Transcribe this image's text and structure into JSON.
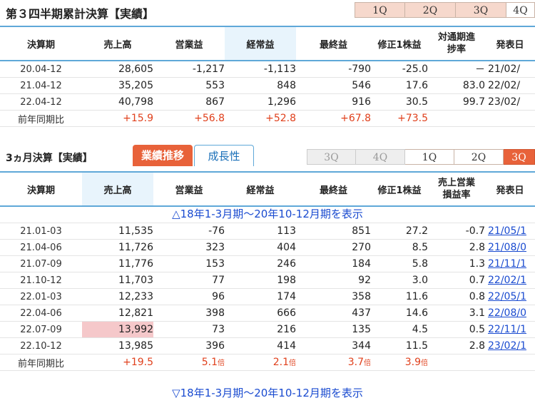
{
  "section1": {
    "title": "第３四半期累計決算【実績】",
    "tabs": [
      "1Q",
      "2Q",
      "3Q",
      "4Q"
    ],
    "headers": [
      "決算期",
      "売上高",
      "営業益",
      "経常益",
      "最終益",
      "修正1株益",
      "対通期進捗率",
      "発表日"
    ],
    "rows": [
      [
        "20.04-12",
        "28,605",
        "-1,217",
        "-1,113",
        "-790",
        "-25.0",
        "－",
        "21/02/"
      ],
      [
        "21.04-12",
        "35,205",
        "553",
        "848",
        "546",
        "17.6",
        "83.0",
        "22/02/"
      ],
      [
        "22.04-12",
        "40,798",
        "867",
        "1,296",
        "916",
        "30.5",
        "99.7",
        "23/02/"
      ]
    ],
    "yoy": [
      "前年同期比",
      "+15.9",
      "+56.8",
      "+52.8",
      "+67.8",
      "+73.5",
      "",
      ""
    ]
  },
  "section2": {
    "title": "3ヵ月決算【実績】",
    "tab_active": "業績推移",
    "tab_other": "成長性",
    "qtabs": [
      "3Q",
      "4Q",
      "1Q",
      "2Q",
      "3Q"
    ],
    "headers": [
      "決算期",
      "売上高",
      "営業益",
      "経常益",
      "最終益",
      "修正1株益",
      "売上営業損益率",
      "発表日"
    ],
    "toggle_top": "△18年1-3月期～20年10-12月期を表示",
    "toggle_bottom": "▽18年1-3月期～20年10-12月期を表示",
    "rows": [
      [
        "21.01-03",
        "11,535",
        "-76",
        "113",
        "851",
        "27.2",
        "-0.7",
        "21/05/1"
      ],
      [
        "21.04-06",
        "11,726",
        "323",
        "404",
        "270",
        "8.5",
        "2.8",
        "21/08/0"
      ],
      [
        "21.07-09",
        "11,776",
        "153",
        "246",
        "184",
        "5.8",
        "1.3",
        "21/11/1"
      ],
      [
        "21.10-12",
        "11,703",
        "77",
        "198",
        "92",
        "3.0",
        "0.7",
        "22/02/1"
      ],
      [
        "22.01-03",
        "12,233",
        "96",
        "174",
        "358",
        "11.6",
        "0.8",
        "22/05/1"
      ],
      [
        "22.04-06",
        "12,821",
        "398",
        "666",
        "437",
        "14.6",
        "3.1",
        "22/08/0"
      ],
      [
        "22.07-09",
        "13,992",
        "73",
        "216",
        "135",
        "4.5",
        "0.5",
        "22/11/1"
      ],
      [
        "22.10-12",
        "13,985",
        "396",
        "414",
        "344",
        "11.5",
        "2.8",
        "23/02/1"
      ]
    ],
    "yoy": {
      "label": "前年同期比",
      "sales": "+19.5",
      "op_num": "5.1",
      "op_unit": "倍",
      "ord_num": "2.1",
      "ord_unit": "倍",
      "net_num": "3.7",
      "net_unit": "倍",
      "eps_num": "3.9",
      "eps_unit": "倍"
    }
  },
  "colors": {
    "accent": "#e8623a",
    "border": "#5fa8d8",
    "red": "#e0401c",
    "link": "#1a4bd0",
    "highlight": "#f5c8ca"
  }
}
